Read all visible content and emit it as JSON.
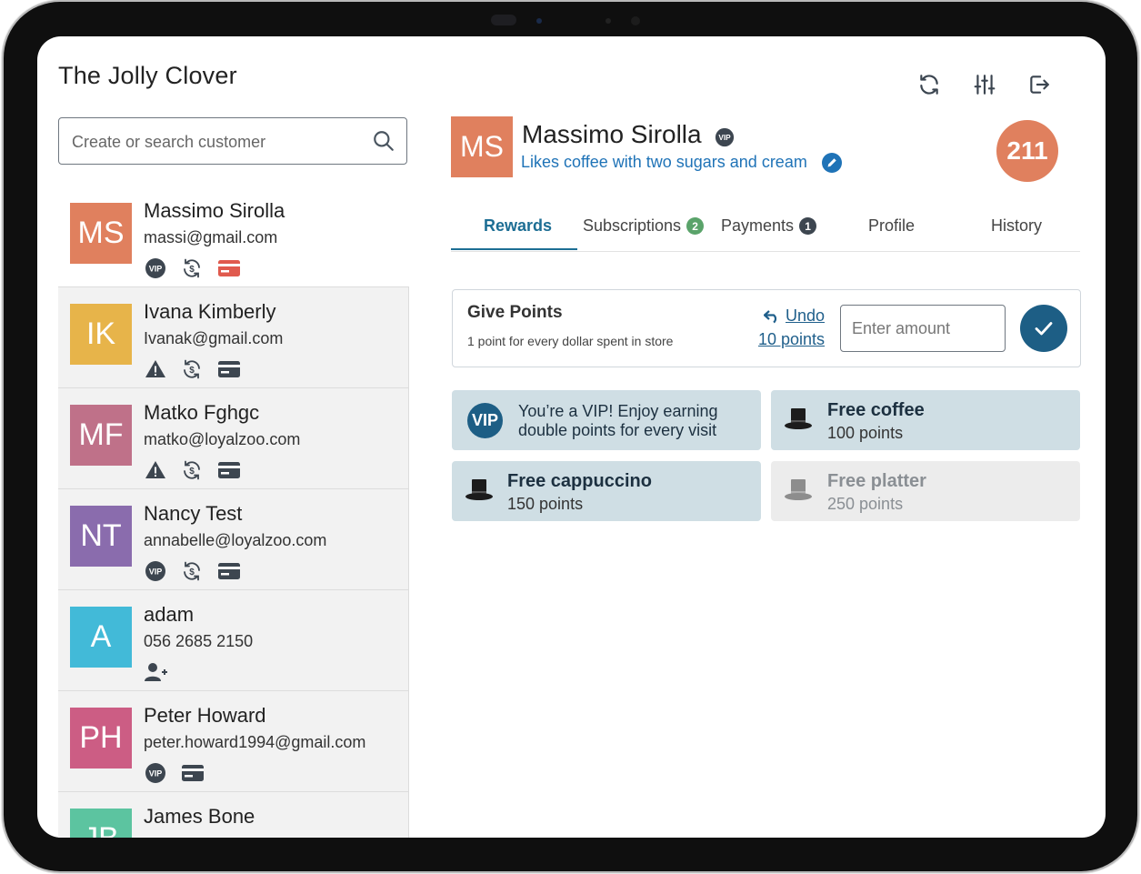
{
  "app": {
    "title": "The Jolly Clover"
  },
  "search": {
    "placeholder": "Create or search customer"
  },
  "customers": [
    {
      "initials": "MS",
      "name": "Massimo Sirolla",
      "contact": "massi@gmail.com",
      "color": "#e0805e"
    },
    {
      "initials": "IK",
      "name": "Ivana Kimberly",
      "contact": "Ivanak@gmail.com",
      "color": "#e7b44a"
    },
    {
      "initials": "MF",
      "name": "Matko Fghgc",
      "contact": "matko@loyalzoo.com",
      "color": "#bf7189"
    },
    {
      "initials": "NT",
      "name": "Nancy Test",
      "contact": "annabelle@loyalzoo.com",
      "color": "#8a6cad"
    },
    {
      "initials": "A",
      "name": "adam",
      "contact": "056 2685 2150",
      "color": "#42bad8"
    },
    {
      "initials": "PH",
      "name": "Peter Howard",
      "contact": "peter.howard1994@gmail.com",
      "color": "#cc5d84"
    },
    {
      "initials": "JB",
      "name": "James Bone",
      "contact": "",
      "color": "#5cc4a0"
    }
  ],
  "selected": {
    "initials": "MS",
    "name": "Massimo Sirolla",
    "vip_label": "VIP",
    "note": "Likes coffee with two sugars and cream",
    "points": "211",
    "avatar_color": "#e0805e"
  },
  "tabs": [
    {
      "label": "Rewards",
      "active": true
    },
    {
      "label": "Subscriptions",
      "count": "2",
      "count_color": "#5aa36a"
    },
    {
      "label": "Payments",
      "count": "1",
      "count_color": "#3d4650"
    },
    {
      "label": "Profile"
    },
    {
      "label": "History"
    }
  ],
  "give_points": {
    "title": "Give Points",
    "subtitle": "1 point for every dollar spent in store",
    "undo_label": "Undo",
    "undo_amount": "10 points",
    "amount_placeholder": "Enter amount"
  },
  "vip_card": {
    "badge": "VIP",
    "line1": "You’re a VIP! Enjoy earning",
    "line2": "double points for every visit"
  },
  "rewards": [
    {
      "name": "Free coffee",
      "points": "100 points",
      "available": true
    },
    {
      "name": "Free cappuccino",
      "points": "150 points",
      "available": true
    },
    {
      "name": "Free platter",
      "points": "250 points",
      "available": false
    }
  ],
  "colors": {
    "accent": "#1d5e85",
    "link": "#1f73b7",
    "warning": "#e05a4e",
    "card_bg": "#cfdee4",
    "card_disabled": "#ececec"
  }
}
